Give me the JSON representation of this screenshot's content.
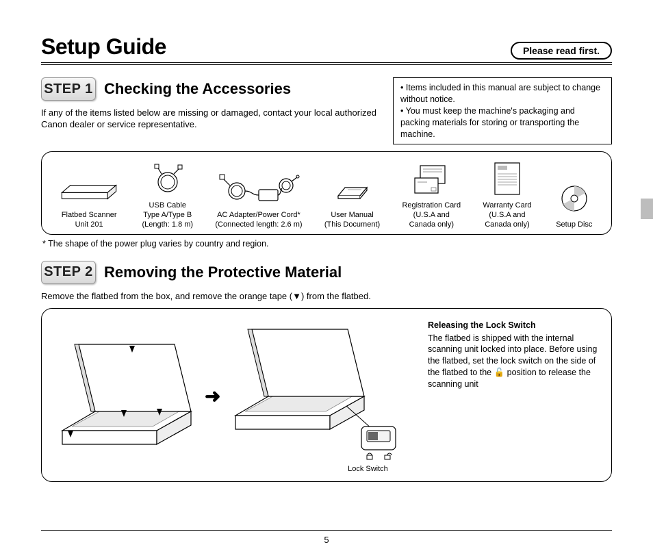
{
  "header": {
    "title": "Setup Guide",
    "read_first": "Please read first."
  },
  "step1": {
    "badge": "STEP 1",
    "heading": "Checking the Accessories",
    "intro": "If any of the items listed below are missing or damaged, contact your local authorized Canon dealer or service representative.",
    "notes": [
      "Items included in this manual are subject to change without notice.",
      "You must keep the machine's packaging and packing materials for storing or transporting the machine."
    ],
    "accessories": [
      {
        "label_lines": [
          "Flatbed Scanner",
          "Unit 201"
        ]
      },
      {
        "label_lines": [
          "USB Cable",
          "Type A/Type B",
          "(Length: 1.8 m)"
        ]
      },
      {
        "label_lines": [
          "AC Adapter/Power Cord*",
          "(Connected length: 2.6 m)"
        ]
      },
      {
        "label_lines": [
          "User Manual",
          "(This Document)"
        ]
      },
      {
        "label_lines": [
          "Registration Card",
          "(U.S.A and",
          "Canada only)"
        ]
      },
      {
        "label_lines": [
          "Warranty Card",
          "(U.S.A and",
          "Canada only)"
        ]
      },
      {
        "label_lines": [
          "Setup Disc"
        ]
      }
    ],
    "footnote": "* The shape of the power plug varies by country and region."
  },
  "step2": {
    "badge": "STEP 2",
    "heading": "Removing the Protective Material",
    "intro": "Remove the flatbed from the box, and remove the orange tape (▼) from the flatbed.",
    "lock_heading": "Releasing the Lock Switch",
    "lock_body": "The flatbed is shipped with the internal scanning unit locked into place. Before using the flatbed, set the lock switch on the side of the flatbed to the 🔓 position to release the scanning unit",
    "lock_label": "Lock Switch"
  },
  "page_number": "5"
}
